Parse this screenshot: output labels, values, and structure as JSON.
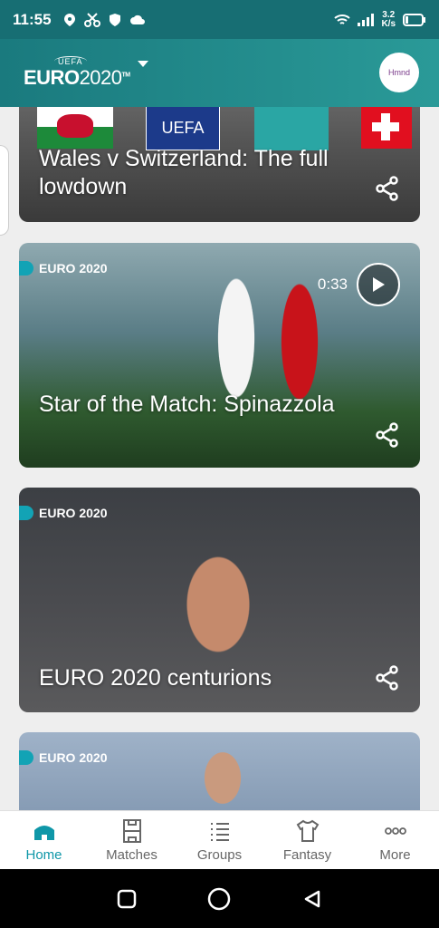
{
  "status_bar": {
    "time": "11:55",
    "net_speed_value": "3.2",
    "net_speed_unit": "K/s"
  },
  "header": {
    "logo_top": "UEFA",
    "logo_main": "EURO",
    "logo_year": "2020",
    "logo_tm": "TM",
    "avatar_text": "Hmnd"
  },
  "cards": [
    {
      "title": "Wales v Switzerland: The full lowdown",
      "banner_text": "UEFA"
    },
    {
      "tag": "EURO 2020",
      "duration": "0:33",
      "title": "Star of the Match: Spinazzola"
    },
    {
      "tag": "EURO 2020",
      "title": "EURO 2020 centurions"
    },
    {
      "tag": "EURO 2020"
    }
  ],
  "bottom_nav": [
    {
      "label": "Home",
      "icon": "stadium-icon",
      "active": true
    },
    {
      "label": "Matches",
      "icon": "pitch-icon"
    },
    {
      "label": "Groups",
      "icon": "list-icon"
    },
    {
      "label": "Fantasy",
      "icon": "shirt-icon"
    },
    {
      "label": "More",
      "icon": "more-dots-icon"
    }
  ],
  "colors": {
    "header": "#1a7a7e",
    "accent": "#0f97a8",
    "status_bar": "#176e73"
  }
}
